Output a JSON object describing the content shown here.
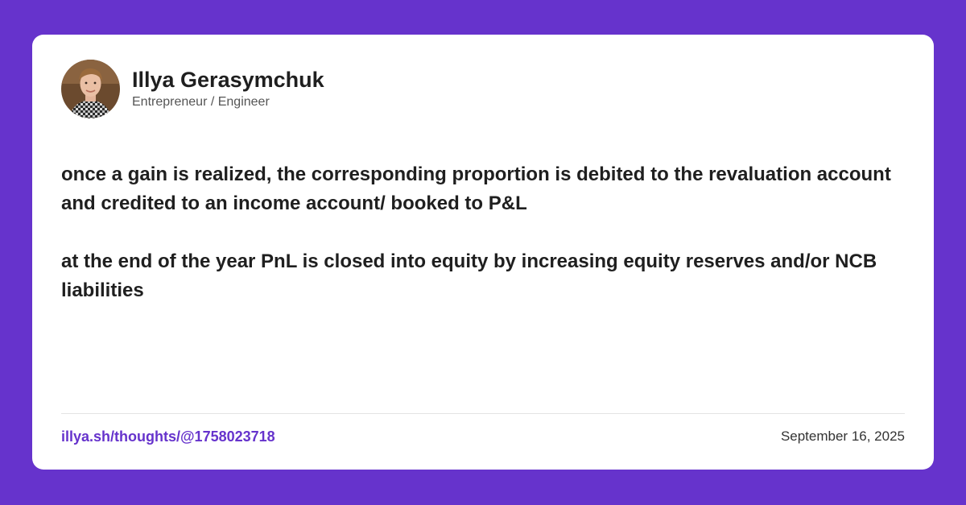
{
  "author": {
    "name": "Illya Gerasymchuk",
    "title": "Entrepreneur / Engineer",
    "avatar_icon": "profile-photo"
  },
  "post": {
    "paragraphs": [
      "once a gain is realized, the corresponding proportion is debited to the revaluation account and credited to an income account/ booked to P&L",
      "at the end of the year PnL is closed into equity by increasing equity reserves and/or NCB liabilities"
    ]
  },
  "footer": {
    "permalink": "illya.sh/thoughts/@1758023718",
    "date": "September 16, 2025"
  },
  "colors": {
    "background": "#6633cc",
    "card": "#ffffff",
    "link": "#6633cc",
    "text": "#1f1f1f"
  }
}
